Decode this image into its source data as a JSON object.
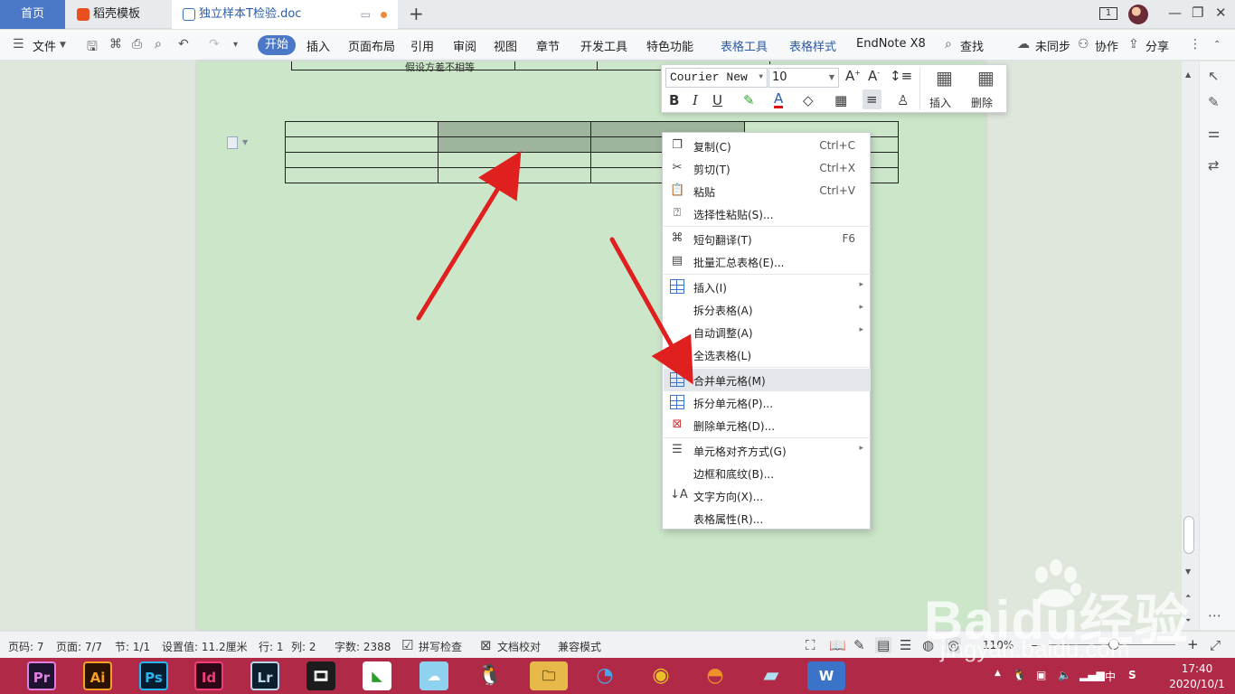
{
  "tabs": {
    "home": "首页",
    "daoke": "稻壳模板",
    "doc": "独立样本T检验.doc",
    "new_tab": "+"
  },
  "window": {
    "count": "1",
    "minimize": "—",
    "maximize": "❐",
    "close": "✕"
  },
  "ribbon": {
    "file": "文件",
    "start": "开始",
    "insert": "插入",
    "page_layout": "页面布局",
    "reference": "引用",
    "review": "审阅",
    "view": "视图",
    "chapter": "章节",
    "dev_tools": "开发工具",
    "special": "特色功能",
    "table_tools": "表格工具",
    "table_style": "表格样式",
    "endnote": "EndNote X8",
    "search": "查找",
    "sync": "未同步",
    "collab": "协作",
    "share": "分享"
  },
  "document": {
    "prev_cell_text": "假设方差不相等"
  },
  "mini_toolbar": {
    "font": "Courier New",
    "size": "10",
    "bold": "B",
    "italic": "I",
    "underline": "U",
    "font_color": "A",
    "insert": "插入",
    "delete": "删除"
  },
  "context_menu": {
    "items": [
      {
        "label": "复制(C)",
        "shortcut": "Ctrl+C"
      },
      {
        "label": "剪切(T)",
        "shortcut": "Ctrl+X"
      },
      {
        "label": "粘贴",
        "shortcut": "Ctrl+V"
      },
      {
        "label": "选择性粘贴(S)...",
        "shortcut": ""
      },
      {
        "label": "短句翻译(T)",
        "shortcut": "F6"
      },
      {
        "label": "批量汇总表格(E)...",
        "shortcut": ""
      },
      {
        "label": "插入(I)",
        "shortcut": ""
      },
      {
        "label": "拆分表格(A)",
        "shortcut": ""
      },
      {
        "label": "自动调整(A)",
        "shortcut": ""
      },
      {
        "label": "全选表格(L)",
        "shortcut": ""
      },
      {
        "label": "合并单元格(M)",
        "shortcut": ""
      },
      {
        "label": "拆分单元格(P)...",
        "shortcut": ""
      },
      {
        "label": "删除单元格(D)...",
        "shortcut": ""
      },
      {
        "label": "单元格对齐方式(G)",
        "shortcut": ""
      },
      {
        "label": "边框和底纹(B)...",
        "shortcut": ""
      },
      {
        "label": "文字方向(X)...",
        "shortcut": ""
      },
      {
        "label": "表格属性(R)...",
        "shortcut": ""
      }
    ]
  },
  "status": {
    "page_code": "页码: 7",
    "page": "页面: 7/7",
    "section": "节: 1/1",
    "setting": "设置值: 11.2厘米",
    "row": "行: 1",
    "col": "列: 2",
    "word_count": "字数: 2388",
    "spell_check": "拼写检查",
    "doc_proof": "文档校对",
    "compat_mode": "兼容模式",
    "zoom": "110%",
    "zoom_minus": "—",
    "zoom_plus": "+"
  },
  "taskbar": {
    "apps": [
      "Pr",
      "Ai",
      "Ps",
      "Id",
      "Lr"
    ],
    "ime": "中",
    "time": "17:40",
    "date": "2020/10/1"
  },
  "watermark": {
    "main": "Baidu经验",
    "url": "jingyan.baidu.com"
  },
  "colors": {
    "accent": "#4a77c6",
    "selected_cell": "#9eb49c",
    "page_bg": "#cbe6c9",
    "arrow": "#e01f1f",
    "taskbar": "#b02a47"
  }
}
